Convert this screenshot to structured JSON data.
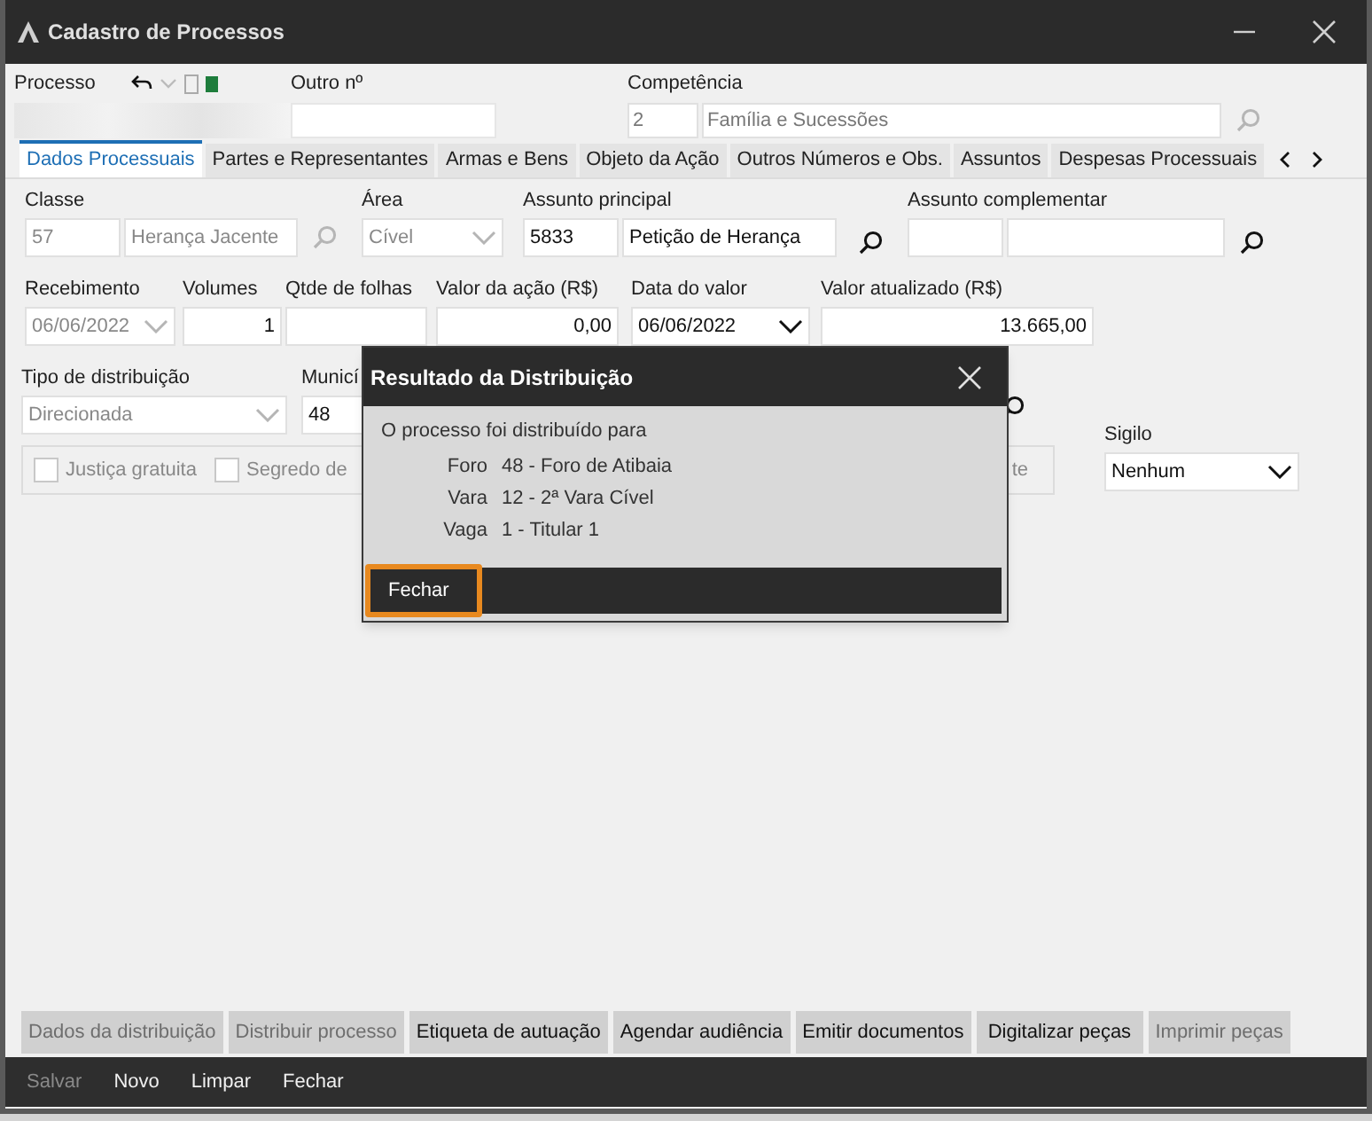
{
  "window": {
    "title": "Cadastro de Processos"
  },
  "header": {
    "processo": {
      "label": "Processo"
    },
    "outro": {
      "label": "Outro nº"
    },
    "competencia": {
      "label": "Competência",
      "code": "2",
      "name": "Família e Sucessões",
      "disabled": true
    }
  },
  "tabs": [
    {
      "label": "Dados Processuais",
      "selected": true
    },
    {
      "label": "Partes e Representantes",
      "selected": false
    },
    {
      "label": "Armas e Bens",
      "selected": false
    },
    {
      "label": "Objeto da Ação",
      "selected": false
    },
    {
      "label": "Outros Números e Obs.",
      "selected": false
    },
    {
      "label": "Assuntos",
      "selected": false
    },
    {
      "label": "Despesas Processuais",
      "selected": false
    }
  ],
  "form": {
    "classe": {
      "label": "Classe",
      "code": "57",
      "name": "Herança Jacente",
      "disabled": true
    },
    "area": {
      "label": "Área",
      "value": "Cível",
      "disabled": true
    },
    "assunto_principal": {
      "label": "Assunto principal",
      "code": "5833",
      "name": "Petição de Herança",
      "disabled": false
    },
    "assunto_complementar": {
      "label": "Assunto complementar"
    },
    "recebimento": {
      "label": "Recebimento",
      "value": "06/06/2022",
      "disabled": true
    },
    "volumes": {
      "label": "Volumes",
      "value": "1"
    },
    "qtde_folhas": {
      "label": "Qtde de folhas"
    },
    "valor_acao": {
      "label": "Valor da ação (R$)",
      "value": "0,00"
    },
    "data_valor": {
      "label": "Data do valor",
      "value": "06/06/2022",
      "disabled": false
    },
    "valor_atualizado": {
      "label": "Valor atualizado (R$)",
      "value": "13.665,00"
    },
    "tipo_distribuicao": {
      "label": "Tipo de distribuição",
      "value": "Direcionada",
      "disabled": true
    },
    "municipio": {
      "label": "Municí",
      "value": "48"
    },
    "sigilo": {
      "label": "Sigilo",
      "value": "Nenhum",
      "disabled": false
    }
  },
  "checkboxes": [
    {
      "label": "Justiça gratuita",
      "checked": false
    },
    {
      "label": "Segredo de",
      "checked": false
    }
  ],
  "checkbox_panel_text": "te",
  "dialog": {
    "title": "Resultado da Distribuição",
    "message": "O processo foi distribuído para",
    "rows": [
      {
        "label": "Foro",
        "value": "48 - Foro de Atibaia"
      },
      {
        "label": "Vara",
        "value": "12 - 2ª Vara Cível"
      },
      {
        "label": "Vaga",
        "value": "1 - Titular 1"
      }
    ],
    "button": "Fechar"
  },
  "actions": [
    {
      "label": "Dados da distribuição",
      "disabled": true
    },
    {
      "label": "Distribuir processo",
      "disabled": true
    },
    {
      "label": "Etiqueta de autuação",
      "disabled": false
    },
    {
      "label": "Agendar audiência",
      "disabled": false
    },
    {
      "label": "Emitir documentos",
      "disabled": false
    },
    {
      "label": "Digitalizar peças",
      "disabled": false
    },
    {
      "label": "Imprimir peças",
      "disabled": true
    }
  ],
  "toolbar": [
    {
      "label": "Salvar",
      "disabled": true
    },
    {
      "label": "Novo",
      "disabled": false
    },
    {
      "label": "Limpar",
      "disabled": false
    },
    {
      "label": "Fechar",
      "disabled": false
    }
  ]
}
